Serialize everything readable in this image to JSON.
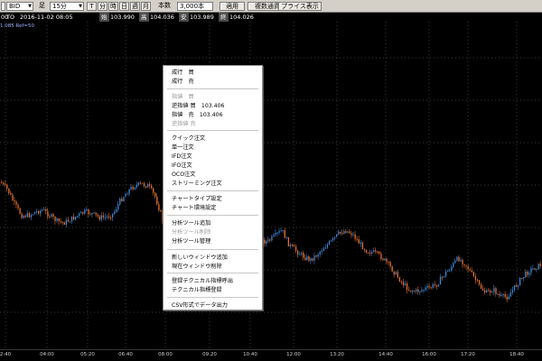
{
  "toolbar": {
    "side_value": "BID",
    "ashi_label": "足",
    "period_value": "15分",
    "btn_tick": "T",
    "btn_minute": "分",
    "btn_hour": "時",
    "btn_day": "日",
    "btn_week": "週",
    "btn_month": "月",
    "count_label": "本数",
    "count_value": "3,000本",
    "apply_label": "適用",
    "multi_pair_label": "複数通貨ペア",
    "price_display_label": "プライス表示"
  },
  "quote": {
    "prefix": "00",
    "code": "TO",
    "datetime": "2016-11-02 08:05",
    "open_label": "始",
    "open_value": "103.990",
    "high_label": "高",
    "high_value": "104.036",
    "low_label": "安",
    "low_value": "103.989",
    "close_label": "終",
    "close_value": "104.026"
  },
  "status_text": "1.085 Ref=50",
  "context_menu": {
    "items": [
      {
        "label": "成行　買",
        "enabled": true
      },
      {
        "label": "成行　売",
        "enabled": true
      },
      {
        "label": "指値　買",
        "enabled": false
      },
      {
        "label": "逆指値 買　103.406",
        "enabled": true
      },
      {
        "label": "指値　売　103.406",
        "enabled": true
      },
      {
        "label": "逆指値 売",
        "enabled": false
      },
      {
        "label": "クイック注文",
        "enabled": true
      },
      {
        "label": "単一注文",
        "enabled": true
      },
      {
        "label": "IFD注文",
        "enabled": true
      },
      {
        "label": "IFO注文",
        "enabled": true
      },
      {
        "label": "OCO注文",
        "enabled": true
      },
      {
        "label": "ストリーミング注文",
        "enabled": true
      },
      {
        "label": "チャートタイプ設定",
        "enabled": true
      },
      {
        "label": "チャート環境設定",
        "enabled": true
      },
      {
        "label": "分析ツール追加",
        "enabled": true
      },
      {
        "label": "分析ツール削除",
        "enabled": false
      },
      {
        "label": "分析ツール管理",
        "enabled": true
      },
      {
        "label": "新しいウィンドウ追加",
        "enabled": true
      },
      {
        "label": "現在ウィンドウ削除",
        "enabled": true
      },
      {
        "label": "登録テクニカル指標呼出",
        "enabled": true
      },
      {
        "label": "テクニカル指標登録",
        "enabled": true
      },
      {
        "label": "CSV形式でデータ出力",
        "enabled": true
      }
    ]
  },
  "xaxis": {
    "labels": [
      "2:40",
      "04:00",
      "05:20",
      "06:40",
      "08:00",
      "09:20",
      "10:40",
      "12:00",
      "13:20",
      "14:40",
      "16:00",
      "17:20",
      "18:40"
    ]
  },
  "colors": {
    "bullish": "#3f87d8",
    "bearish": "#e07030",
    "grid": "#3a3a3a",
    "background": "#000000"
  },
  "chart_data": {
    "type": "candlestick",
    "xlabel": "",
    "ylabel": "",
    "grid": true,
    "x_tick_labels": [
      "2:40",
      "04:00",
      "05:20",
      "06:40",
      "08:00",
      "09:20",
      "10:40",
      "12:00",
      "13:20",
      "14:40",
      "16:00",
      "17:20",
      "18:40"
    ],
    "close_path_shape": [
      0.62,
      0.58,
      0.5,
      0.44,
      0.44,
      0.46,
      0.47,
      0.44,
      0.41,
      0.4,
      0.42,
      0.44,
      0.46,
      0.45,
      0.43,
      0.43,
      0.45,
      0.52,
      0.57,
      0.6,
      0.61,
      0.6,
      0.54,
      0.42,
      0.38,
      0.36,
      0.37,
      0.38,
      0.37,
      0.36,
      0.34,
      0.35,
      0.36,
      0.36,
      0.37,
      0.36,
      0.34,
      0.3,
      0.3,
      0.33,
      0.36,
      0.28,
      0.25,
      0.22,
      0.2,
      0.23,
      0.27,
      0.3,
      0.34,
      0.36,
      0.34,
      0.29,
      0.25,
      0.24,
      0.22,
      0.18,
      0.13,
      0.08,
      0.04,
      0.03,
      0.04,
      0.05,
      0.07,
      0.12,
      0.16,
      0.21,
      0.18,
      0.12,
      0.06,
      0.02,
      0.04,
      0.0,
      0.0,
      0.05,
      0.1,
      0.14,
      0.16,
      0.18
    ]
  }
}
